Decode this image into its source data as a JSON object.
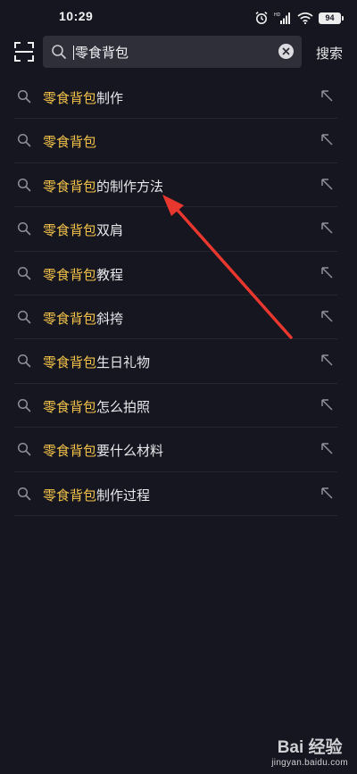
{
  "status_bar": {
    "time": "10:29",
    "battery": "94",
    "network": "HD"
  },
  "search": {
    "query": "零食背包",
    "button_label": "搜索"
  },
  "suggestions": [
    {
      "highlight": "零食背包",
      "rest": "制作"
    },
    {
      "highlight": "零食背包",
      "rest": ""
    },
    {
      "highlight": "零食背包",
      "rest": "的制作方法"
    },
    {
      "highlight": "零食背包",
      "rest": "双肩"
    },
    {
      "highlight": "零食背包",
      "rest": "教程"
    },
    {
      "highlight": "零食背包",
      "rest": "斜挎"
    },
    {
      "highlight": "零食背包",
      "rest": "生日礼物"
    },
    {
      "highlight": "零食背包",
      "rest": "怎么拍照"
    },
    {
      "highlight": "零食背包",
      "rest": "要什么材料"
    },
    {
      "highlight": "零食背包",
      "rest": "制作过程"
    }
  ],
  "colors": {
    "background": "#15161f",
    "highlight": "#f2c24a",
    "annotation_arrow": "#e8372e"
  },
  "icons": {
    "scan": "scan-icon",
    "search": "search-icon",
    "clear": "clear-icon",
    "fill_suggestion": "arrow-up-left-icon"
  },
  "watermark": {
    "brand": "Bai 经验",
    "domain": "jingyan.baidu.com"
  }
}
